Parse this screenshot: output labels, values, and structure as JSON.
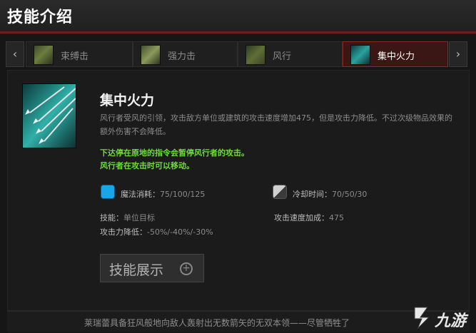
{
  "header": {
    "title": "技能介绍"
  },
  "tabs": [
    {
      "label": "束缚击",
      "icon": "shackleshot-icon",
      "active": false
    },
    {
      "label": "强力击",
      "icon": "powershot-icon",
      "active": false
    },
    {
      "label": "风行",
      "icon": "windrun-icon",
      "active": false
    },
    {
      "label": "集中火力",
      "icon": "focus-fire-icon",
      "active": true
    }
  ],
  "nav": {
    "prev_glyph": "‹",
    "next_glyph": "›"
  },
  "skill": {
    "name": "集中火力",
    "icon": "focus-fire-icon",
    "description": "风行者受风的引领，攻击敌方单位或建筑的攻击速度增加475，但是攻击力降低。不过次级物品效果的额外伤害不会降低。",
    "note_line1": "下达停在原地的指令会暂停风行者的攻击。",
    "note_line2": "风行者在攻击时可以移动。",
    "mana_label": "魔法消耗：",
    "mana_value": "75/100/125",
    "cooldown_label": "冷却时间：",
    "cooldown_value": "70/50/30",
    "target_label": "技能：",
    "target_value": "单位目标",
    "aspd_label": "攻击速度加成：",
    "aspd_value": "475",
    "dmg_label": "攻击力降低：",
    "dmg_value": "-50%/-40%/-30%"
  },
  "demo_button": {
    "label": "技能展示",
    "plus": "+"
  },
  "footer": {
    "lore": "莱瑞蕾具备狂风般地向敌人轰射出无数箭矢的无双本领——尽管牺牲了"
  },
  "watermark": {
    "text": "九游"
  },
  "colors": {
    "accent": "#8a2a22",
    "note_green": "#6fdc3a",
    "mana_blue": "#18a6e8"
  }
}
